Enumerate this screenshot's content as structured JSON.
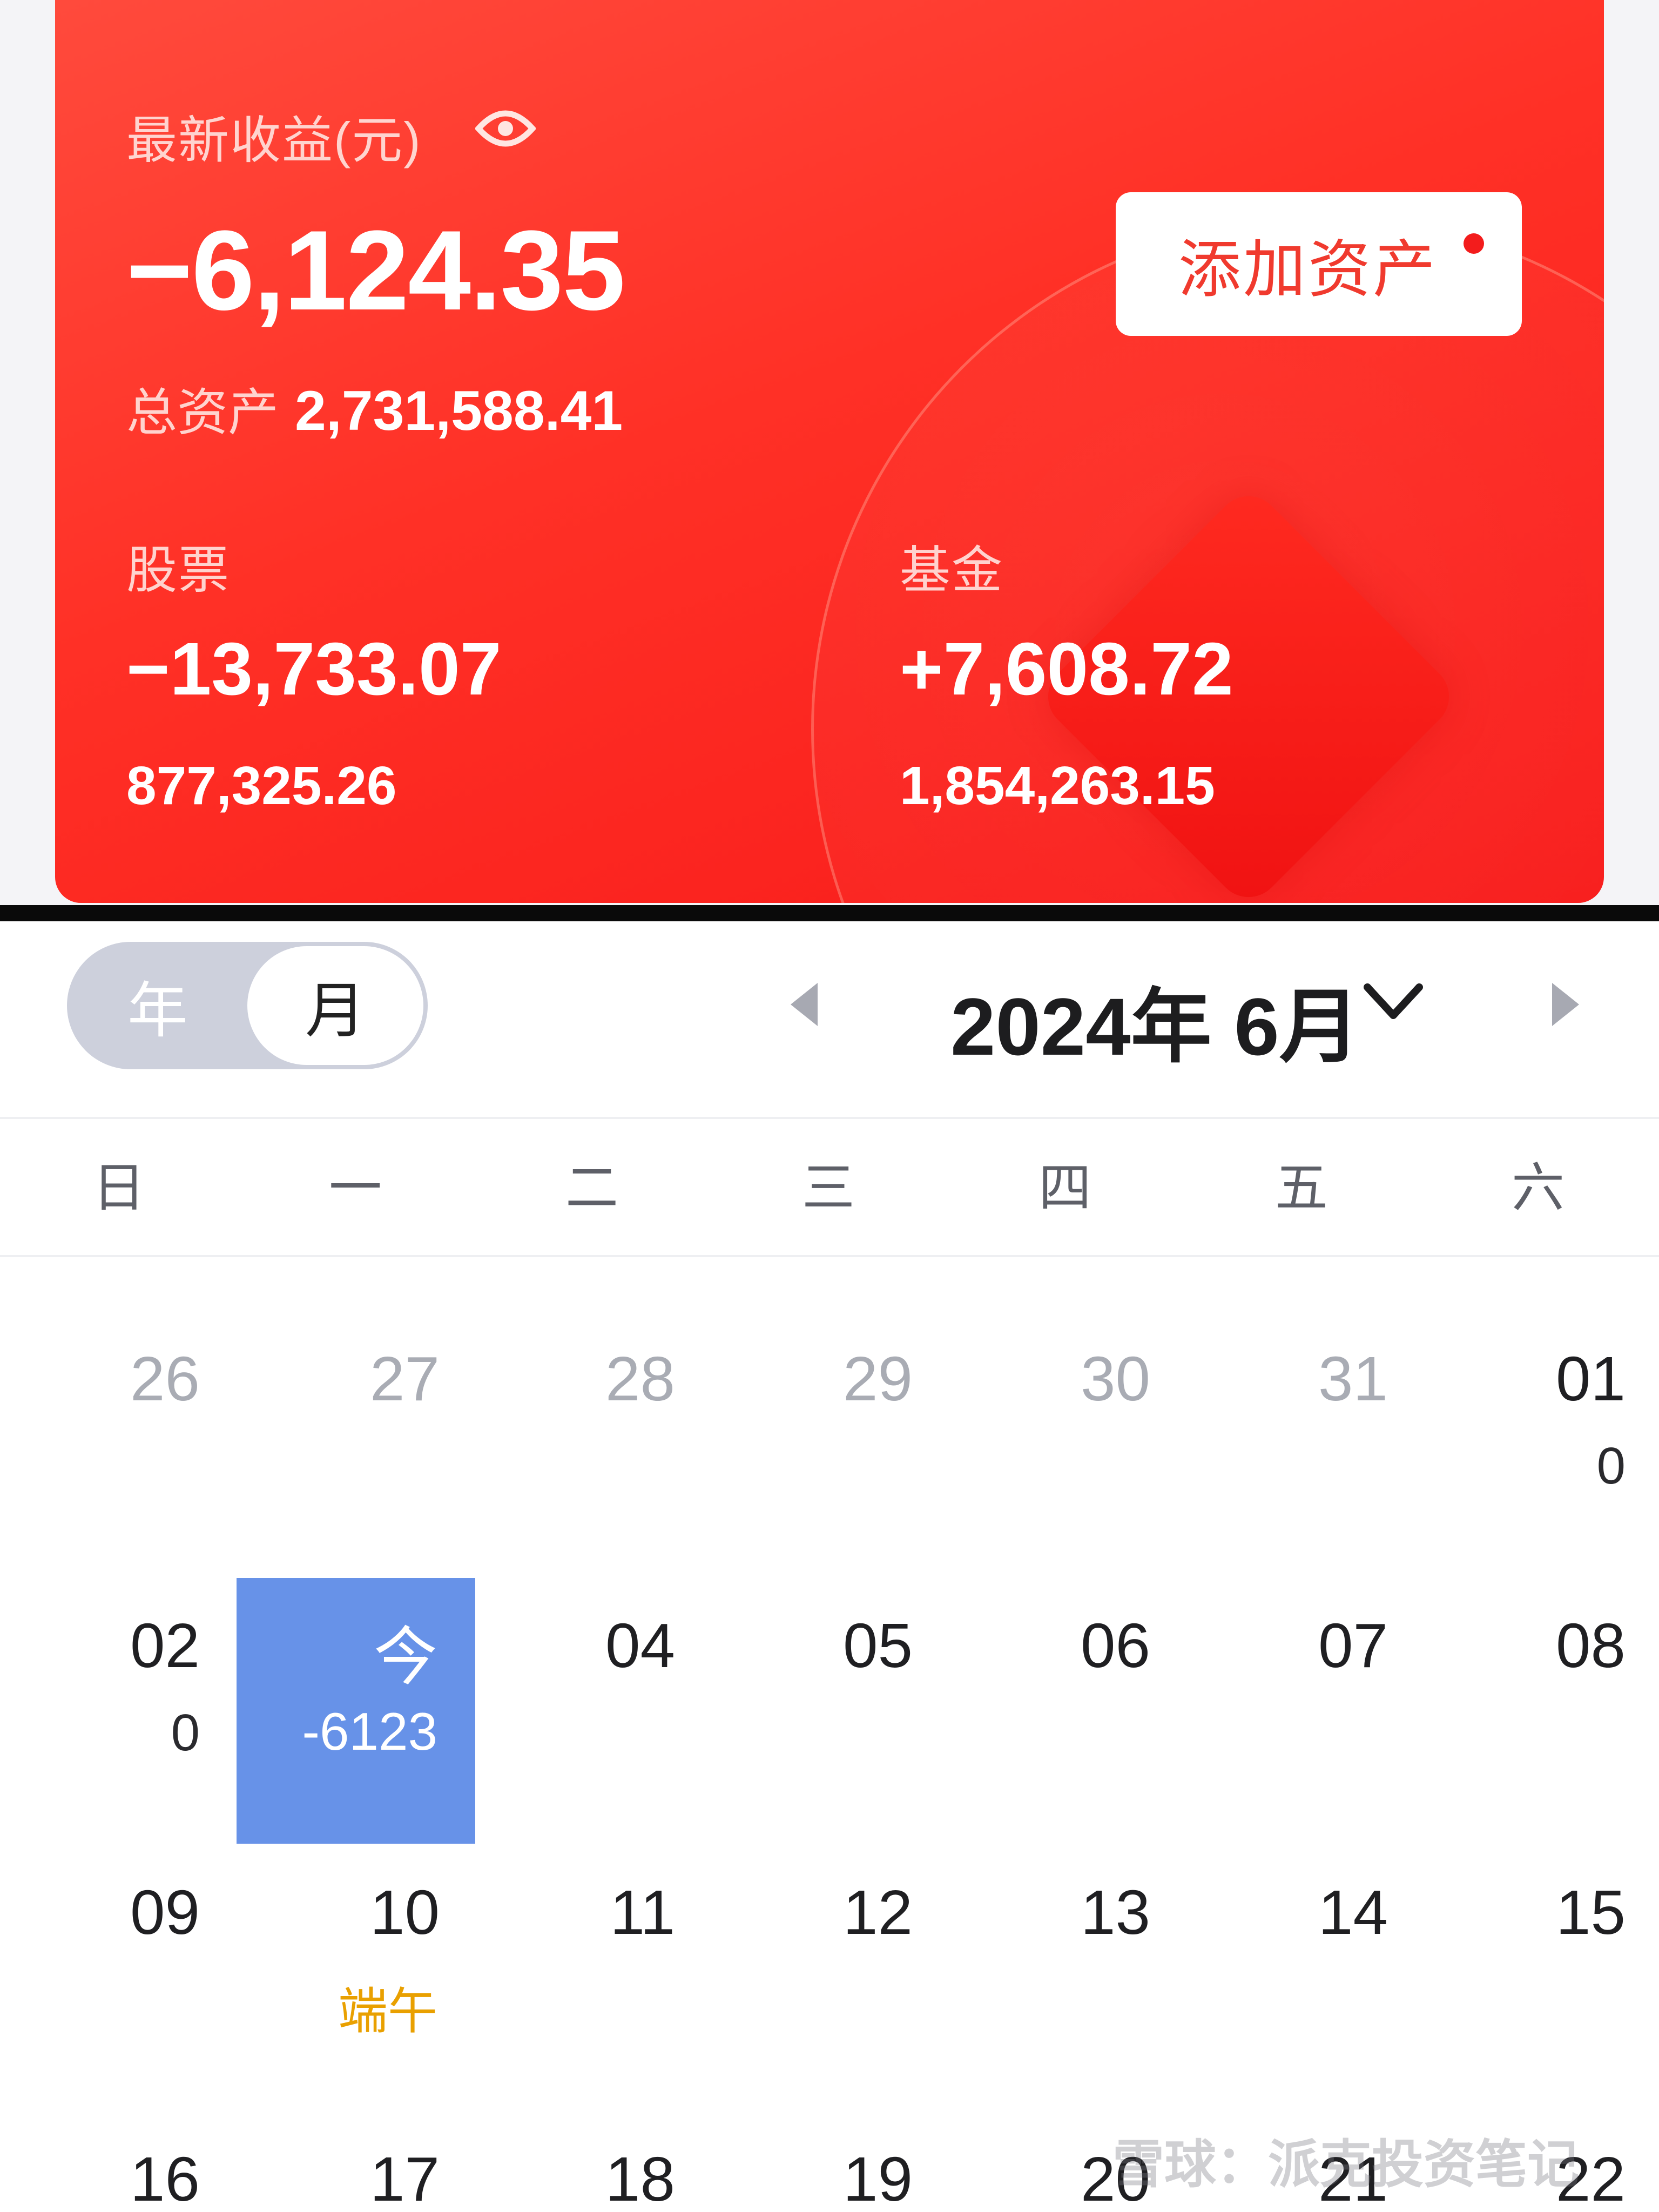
{
  "card": {
    "latest_income_label": "最新收益(元)",
    "latest_income_value": "−6,124.35",
    "total_assets_label": "总资产",
    "total_assets_value": "2,731,588.41",
    "add_asset_button": "添加资产",
    "stocks": {
      "label": "股票",
      "change": "−13,733.07",
      "amount": "877,325.26"
    },
    "funds": {
      "label": "基金",
      "change": "+7,608.72",
      "amount": "1,854,263.15"
    }
  },
  "calendar": {
    "toggle": {
      "year": "年",
      "month": "月",
      "selected": "月"
    },
    "title": "2024年 6月",
    "weekdays": [
      "日",
      "一",
      "二",
      "三",
      "四",
      "五",
      "六"
    ],
    "row1": [
      "26",
      "27",
      "28",
      "29",
      "30",
      "31",
      "01"
    ],
    "row1_sub_sat": "0",
    "row2": [
      "02",
      "今",
      "04",
      "05",
      "06",
      "07",
      "08"
    ],
    "row2_sub_sun": "0",
    "today_value": "-6123",
    "row3": [
      "09",
      "10",
      "11",
      "12",
      "13",
      "14",
      "15"
    ],
    "holiday": "端午",
    "row4": [
      "16",
      "17",
      "18",
      "19",
      "20",
      "21",
      "22"
    ]
  },
  "watermark": "雪球：派克投资笔记",
  "colors": {
    "card_red": "#ff3026",
    "today_blue": "#6792e8",
    "holiday_orange": "#e9a000"
  },
  "icons": [
    "eye-icon",
    "arrow-left-icon",
    "chevron-down-icon",
    "arrow-right-icon"
  ]
}
